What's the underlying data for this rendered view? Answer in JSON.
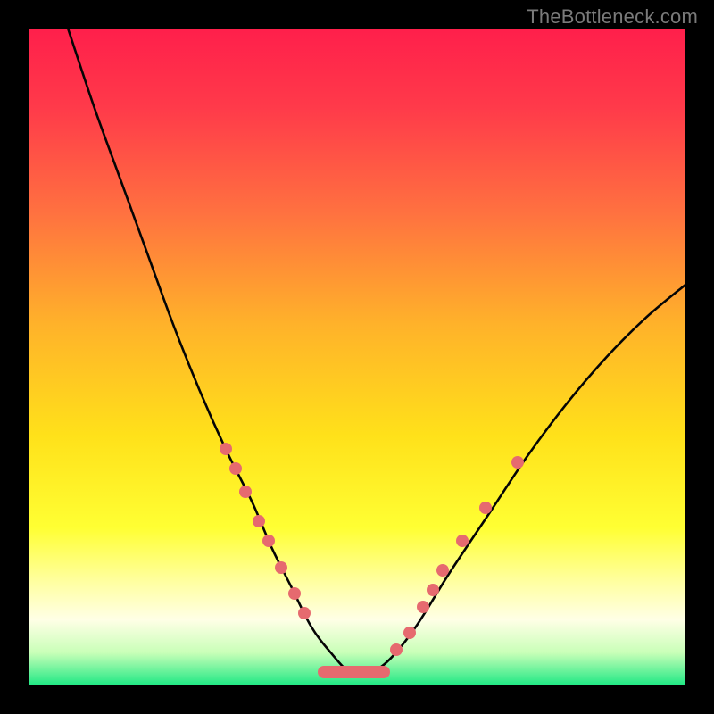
{
  "watermark": "TheBottleneck.com",
  "gradient_stops": [
    {
      "pct": 0,
      "color": "#ff1f4b"
    },
    {
      "pct": 12,
      "color": "#ff3a4a"
    },
    {
      "pct": 28,
      "color": "#ff7140"
    },
    {
      "pct": 45,
      "color": "#ffb22a"
    },
    {
      "pct": 62,
      "color": "#ffe11a"
    },
    {
      "pct": 76,
      "color": "#ffff33"
    },
    {
      "pct": 84,
      "color": "#ffff9e"
    },
    {
      "pct": 90,
      "color": "#ffffe6"
    },
    {
      "pct": 95,
      "color": "#c9ffb8"
    },
    {
      "pct": 100,
      "color": "#1ee884"
    }
  ],
  "colors": {
    "curve": "#050505",
    "dots": "#e66a6f",
    "frame_bg": "#000000"
  },
  "chart_data": {
    "type": "line",
    "title": "",
    "xlabel": "",
    "ylabel": "",
    "xlim": [
      0,
      100
    ],
    "ylim": [
      0,
      100
    ],
    "series": [
      {
        "name": "bottleneck-curve",
        "x": [
          6,
          10,
          14,
          18,
          22,
          26,
          30,
          34,
          37,
          40,
          43,
          46,
          49,
          52,
          55,
          59,
          64,
          70,
          76,
          82,
          88,
          94,
          100
        ],
        "y": [
          100,
          88,
          77,
          66,
          55,
          45,
          36,
          28,
          21,
          15,
          9,
          5,
          2,
          2,
          4,
          9,
          17,
          26,
          35,
          43,
          50,
          56,
          61
        ]
      }
    ],
    "highlight_points_left": [
      {
        "x": 30.0,
        "y": 36.0
      },
      {
        "x": 31.5,
        "y": 33.0
      },
      {
        "x": 33.0,
        "y": 29.5
      },
      {
        "x": 35.0,
        "y": 25.0
      },
      {
        "x": 36.5,
        "y": 22.0
      },
      {
        "x": 38.5,
        "y": 18.0
      },
      {
        "x": 40.5,
        "y": 14.0
      },
      {
        "x": 42.0,
        "y": 11.0
      }
    ],
    "highlight_points_right": [
      {
        "x": 56.0,
        "y": 5.5
      },
      {
        "x": 58.0,
        "y": 8.0
      },
      {
        "x": 60.0,
        "y": 12.0
      },
      {
        "x": 61.5,
        "y": 14.5
      },
      {
        "x": 63.0,
        "y": 17.5
      },
      {
        "x": 66.0,
        "y": 22.0
      },
      {
        "x": 69.5,
        "y": 27.0
      },
      {
        "x": 74.5,
        "y": 34.0
      }
    ],
    "bottom_bar": {
      "x_start": 44,
      "x_end": 55,
      "y": 2
    }
  }
}
